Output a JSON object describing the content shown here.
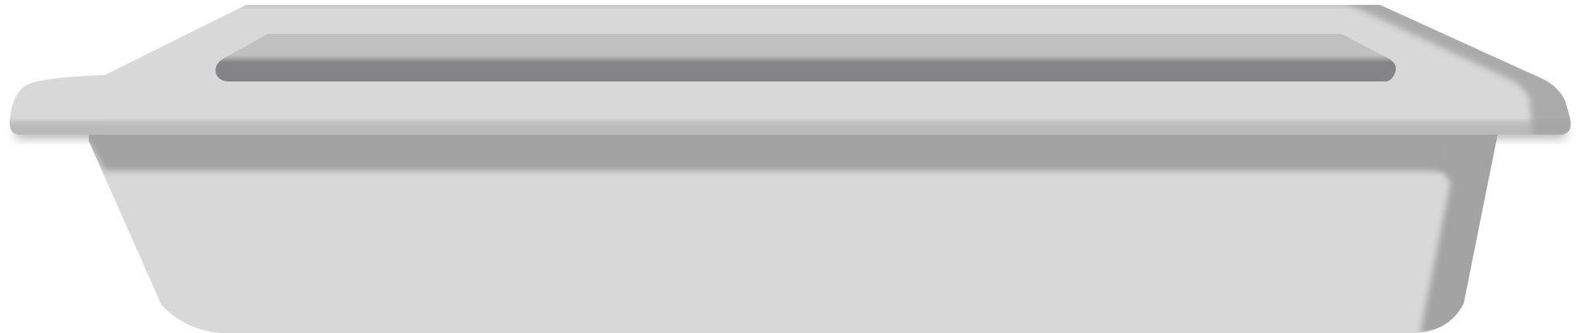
{
  "object": {
    "name": "tray",
    "colors": {
      "body": "#d8d8d8",
      "shadow": "#a3a3a3",
      "slot_top": "#c0c0c0",
      "slot_bottom": "#848486",
      "background": "#ffffff"
    }
  }
}
